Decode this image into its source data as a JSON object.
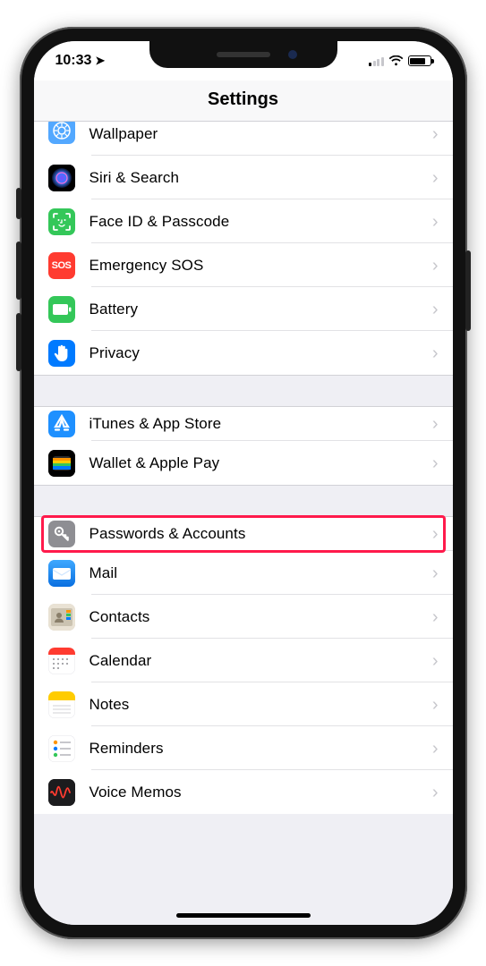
{
  "status": {
    "time": "10:33",
    "location_arrow": "➤",
    "battery_pct": 70
  },
  "header": {
    "title": "Settings"
  },
  "sections": [
    {
      "rows": [
        {
          "id": "wallpaper",
          "label": "Wallpaper",
          "icon_bg": "#53a8ff",
          "icon": "wallpaper",
          "first": true
        },
        {
          "id": "siri",
          "label": "Siri & Search",
          "icon_bg": "#1a1a2e",
          "icon": "siri"
        },
        {
          "id": "faceid",
          "label": "Face ID & Passcode",
          "icon_bg": "#34c759",
          "icon": "face"
        },
        {
          "id": "sos",
          "label": "Emergency SOS",
          "icon_bg": "#ff3b30",
          "icon": "sos",
          "icon_text": "SOS"
        },
        {
          "id": "battery",
          "label": "Battery",
          "icon_bg": "#34c759",
          "icon": "battery"
        },
        {
          "id": "privacy",
          "label": "Privacy",
          "icon_bg": "#007aff",
          "icon": "hand"
        }
      ]
    },
    {
      "rows": [
        {
          "id": "itunes",
          "label": "iTunes & App Store",
          "icon_bg": "#1e90ff",
          "icon": "appstore"
        },
        {
          "id": "wallet",
          "label": "Wallet & Apple Pay",
          "icon_bg": "#000000",
          "icon": "wallet"
        }
      ]
    },
    {
      "rows": [
        {
          "id": "passwords",
          "label": "Passwords & Accounts",
          "icon_bg": "#8e8e93",
          "icon": "key",
          "highlight": true
        },
        {
          "id": "mail",
          "label": "Mail",
          "icon_bg": "#1e90ff",
          "icon": "mail"
        },
        {
          "id": "contacts",
          "label": "Contacts",
          "icon_bg": "#d9d2c5",
          "icon": "contacts"
        },
        {
          "id": "calendar",
          "label": "Calendar",
          "icon_bg": "#ffffff",
          "icon": "calendar"
        },
        {
          "id": "notes",
          "label": "Notes",
          "icon_bg": "#ffffff",
          "icon": "notes"
        },
        {
          "id": "reminders",
          "label": "Reminders",
          "icon_bg": "#ffffff",
          "icon": "reminders"
        },
        {
          "id": "voicememos",
          "label": "Voice Memos",
          "icon_bg": "#1c1c1e",
          "icon": "voicememos"
        }
      ]
    }
  ]
}
